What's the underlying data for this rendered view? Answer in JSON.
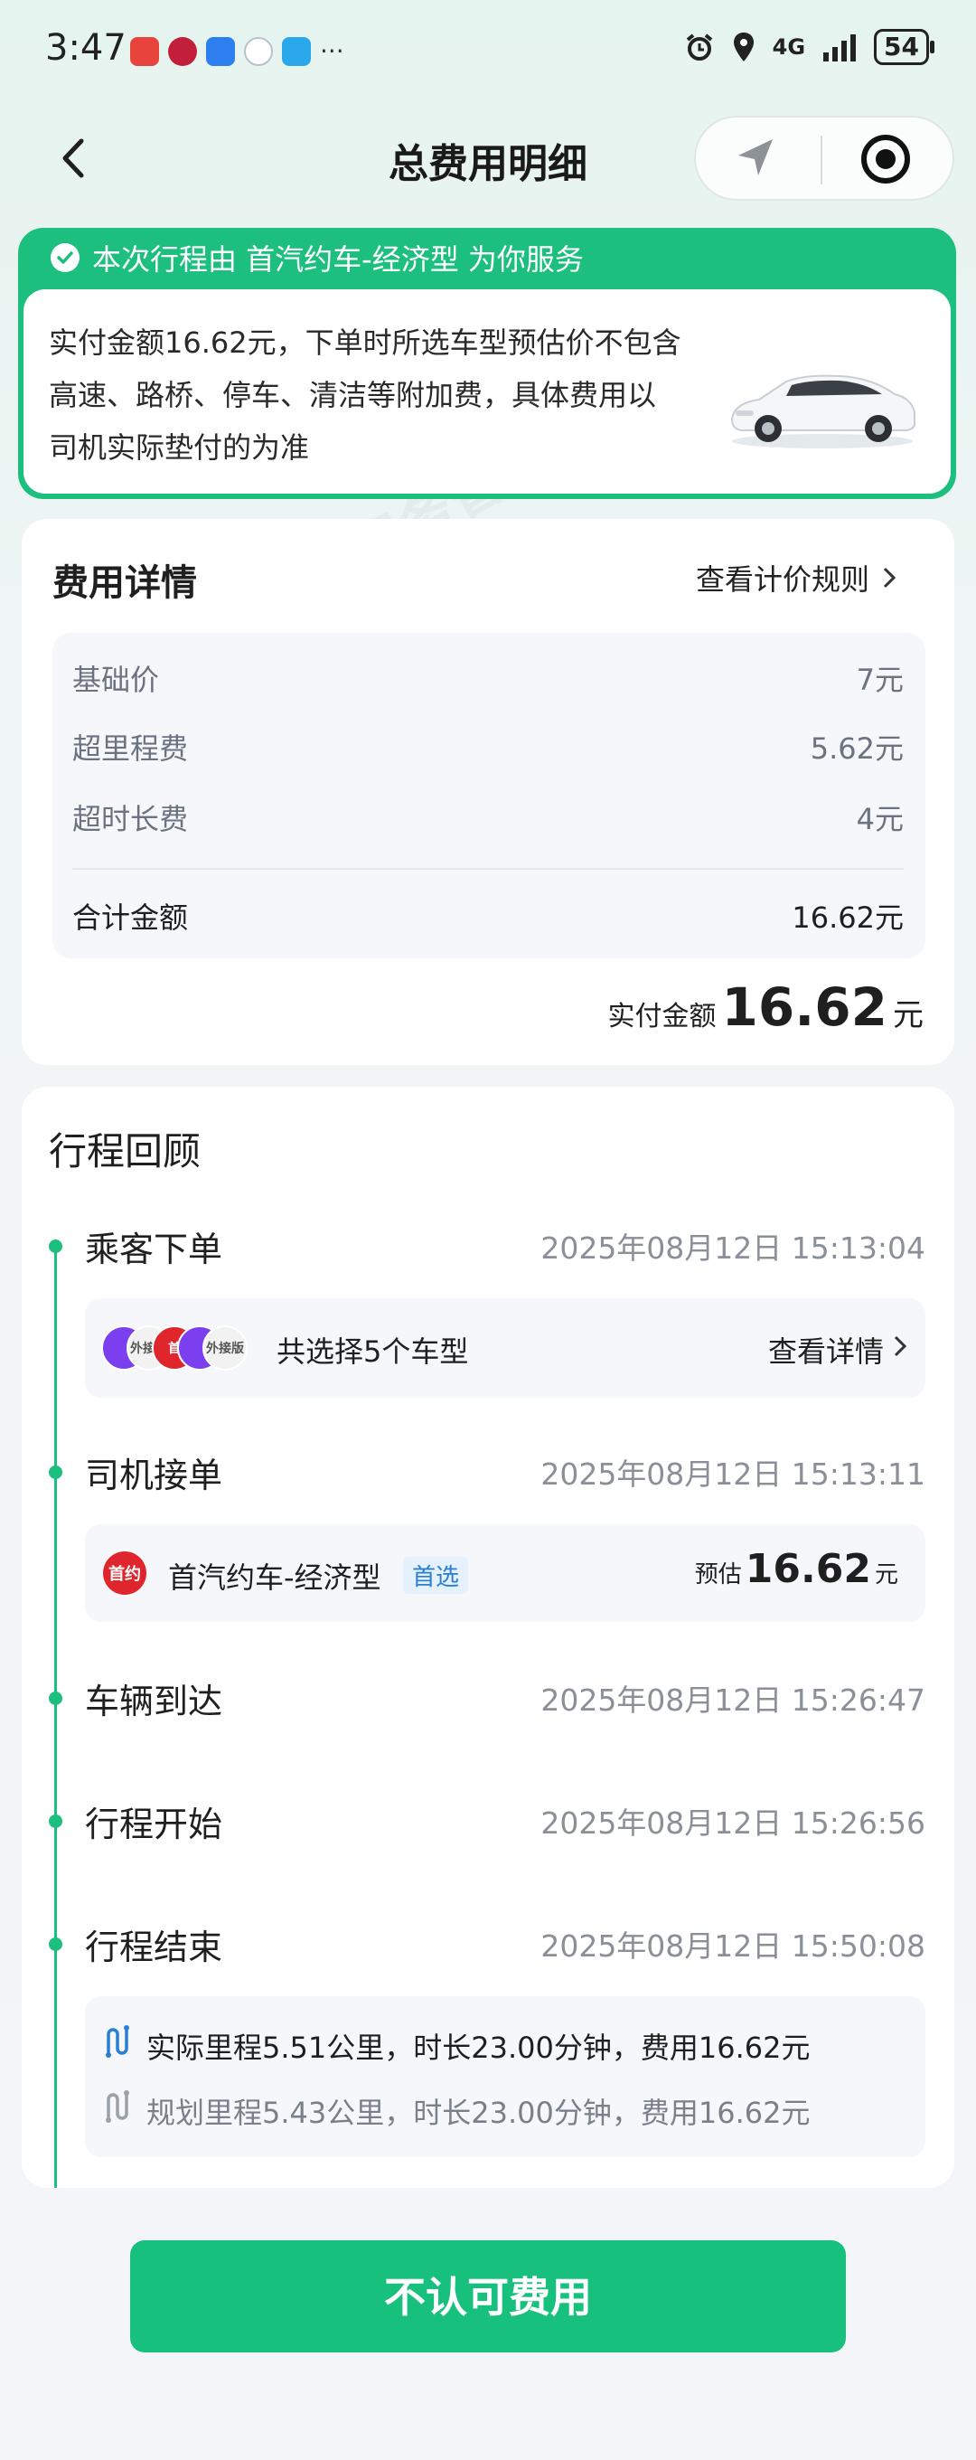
{
  "status_bar": {
    "time": "3:47",
    "network": "4G",
    "battery": "54",
    "more": "···"
  },
  "nav": {
    "title": "总费用明细"
  },
  "banner": {
    "header": "本次行程由 首汽约车-经济型 为你服务",
    "body": "实付金额16.62元，下单时所选车型预估价不包含高速、路桥、停车、清洁等附加费，具体费用以司机实际垫付的为准"
  },
  "fee_detail": {
    "title": "费用详情",
    "rules_link": "查看计价规则",
    "rows": [
      {
        "label": "基础价",
        "value": "7元"
      },
      {
        "label": "超里程费",
        "value": "5.62元"
      },
      {
        "label": "超时长费",
        "value": "4元"
      }
    ],
    "total_label": "合计金额",
    "total_value": "16.62元",
    "paid_label": "实付金额",
    "paid_amount": "16.62",
    "paid_unit": "元"
  },
  "trip_review": {
    "title": "行程回顾",
    "events": [
      {
        "label": "乘客下单",
        "time": "2025年08月12日 15:13:04"
      },
      {
        "label": "司机接单",
        "time": "2025年08月12日 15:13:11"
      },
      {
        "label": "车辆到达",
        "time": "2025年08月12日 15:26:47"
      },
      {
        "label": "行程开始",
        "time": "2025年08月12日 15:26:56"
      },
      {
        "label": "行程结束",
        "time": "2025年08月12日 15:50:08"
      }
    ],
    "order_box": {
      "text": "共选择5个车型",
      "link": "查看详情",
      "logos": [
        "外接版",
        "首",
        "外接版"
      ]
    },
    "accept_box": {
      "logo": "首约",
      "car_type": "首汽约车-经济型",
      "tag": "首选",
      "estimate_label": "预估",
      "estimate_amount": "16.62",
      "estimate_unit": "元"
    },
    "end_box": {
      "actual": "实际里程5.51公里，时长23.00分钟，费用16.62元",
      "planned": "规划里程5.43公里，时长23.00分钟，费用16.62元"
    }
  },
  "bottom_button": {
    "label": "不认可费用"
  },
  "watermark": "您身边的消费服务管家",
  "colors": {
    "accent": "#1cbf7e",
    "tag_blue": "#2a7fd4"
  }
}
